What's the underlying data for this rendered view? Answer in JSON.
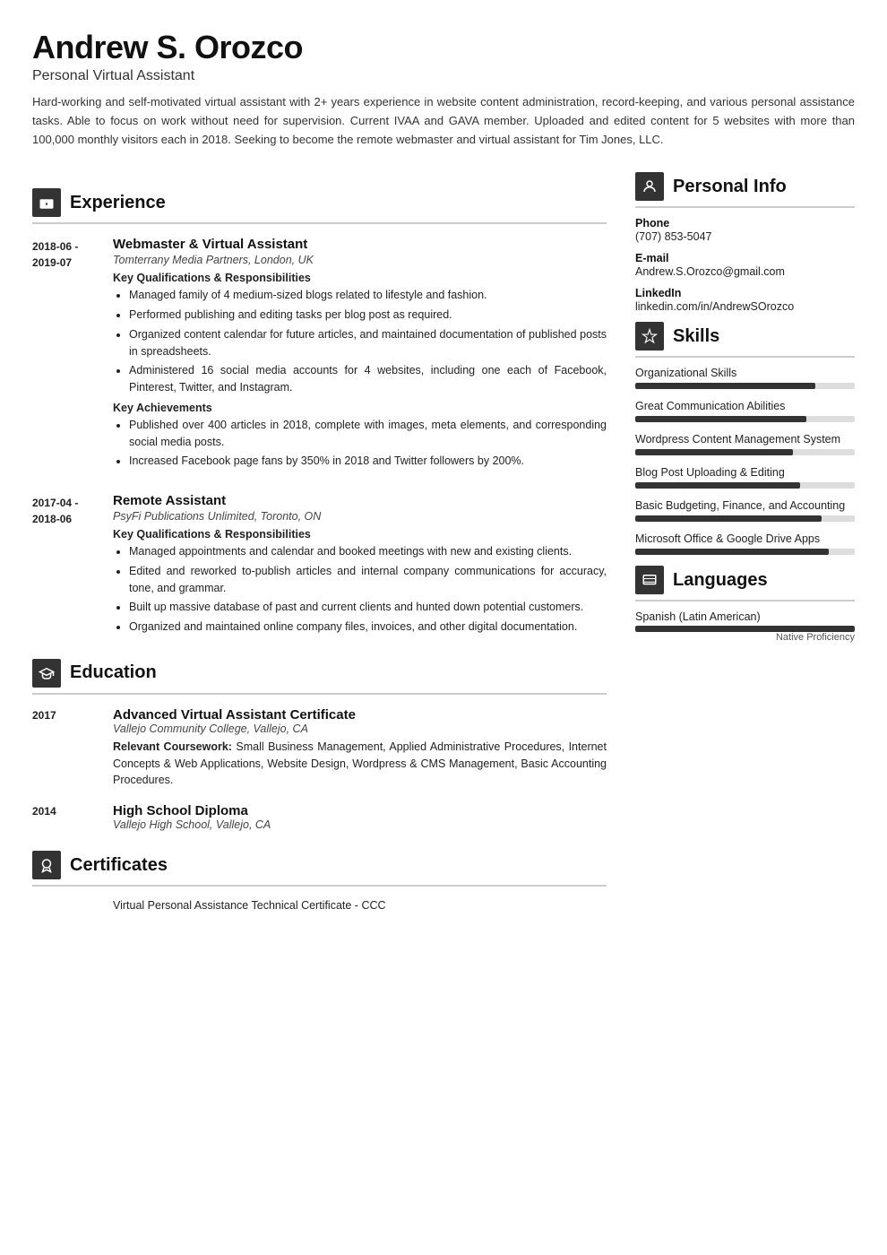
{
  "header": {
    "name": "Andrew S. Orozco",
    "title": "Personal Virtual Assistant",
    "summary": "Hard-working and self-motivated virtual assistant with 2+ years experience in website content administration, record-keeping, and various personal assistance tasks. Able to focus on work without need for supervision. Current IVAA and GAVA member. Uploaded and edited content for 5 websites with more than 100,000 monthly visitors each in 2018. Seeking to become the remote webmaster and virtual assistant for Tim Jones, LLC."
  },
  "experience": {
    "section_label": "Experience",
    "section_icon": "💼",
    "entries": [
      {
        "date": "2018-06 -\n2019-07",
        "title": "Webmaster & Virtual Assistant",
        "company": "Tomterrany Media Partners, London, UK",
        "qualifications_heading": "Key Qualifications & Responsibilities",
        "qualifications": [
          "Managed family of 4 medium-sized blogs related to lifestyle and fashion.",
          "Performed publishing and editing tasks per blog post as required.",
          "Organized content calendar for future articles, and maintained documentation of published posts in spreadsheets.",
          "Administered 16 social media accounts for 4 websites, including one each of Facebook, Pinterest, Twitter, and Instagram."
        ],
        "achievements_heading": "Key Achievements",
        "achievements": [
          "Published over 400 articles in 2018, complete with images, meta elements, and corresponding social media posts.",
          "Increased Facebook page fans by 350% in 2018 and Twitter followers by 200%."
        ]
      },
      {
        "date": "2017-04 -\n2018-06",
        "title": "Remote Assistant",
        "company": "PsyFi Publications Unlimited, Toronto, ON",
        "qualifications_heading": "Key Qualifications & Responsibilities",
        "qualifications": [
          "Managed appointments and calendar and booked meetings with new and existing clients.",
          "Edited and reworked to-publish articles and internal company communications for accuracy, tone, and grammar.",
          "Built up massive database of past and current clients and hunted down potential customers.",
          "Organized and maintained online company files, invoices, and other digital documentation."
        ],
        "achievements_heading": "",
        "achievements": []
      }
    ]
  },
  "education": {
    "section_label": "Education",
    "section_icon": "🎓",
    "entries": [
      {
        "date": "2017",
        "title": "Advanced Virtual Assistant Certificate",
        "school": "Vallejo Community College, Vallejo, CA",
        "coursework_label": "Relevant Coursework:",
        "coursework": "Small Business Management, Applied Administrative Procedures, Internet Concepts & Web Applications, Website Design, Wordpress & CMS Management, Basic Accounting Procedures."
      },
      {
        "date": "2014",
        "title": "High School Diploma",
        "school": "Vallejo High School, Vallejo, CA",
        "coursework_label": "",
        "coursework": ""
      }
    ]
  },
  "certificates": {
    "section_label": "Certificates",
    "section_icon": "🏅",
    "entries": [
      {
        "date": "",
        "text": "Virtual Personal Assistance Technical Certificate - CCC"
      }
    ]
  },
  "personal_info": {
    "section_label": "Personal Info",
    "section_icon": "👤",
    "fields": [
      {
        "label": "Phone",
        "value": "(707) 853-5047"
      },
      {
        "label": "E-mail",
        "value": "Andrew.S.Orozco@gmail.com"
      },
      {
        "label": "LinkedIn",
        "value": "linkedin.com/in/AndrewSOrozco"
      }
    ]
  },
  "skills": {
    "section_label": "Skills",
    "section_icon": "⚙",
    "items": [
      {
        "name": "Organizational Skills",
        "percent": 82
      },
      {
        "name": "Great Communication Abilities",
        "percent": 78
      },
      {
        "name": "Wordpress Content Management System",
        "percent": 72
      },
      {
        "name": "Blog Post Uploading & Editing",
        "percent": 75
      },
      {
        "name": "Basic Budgeting, Finance, and Accounting",
        "percent": 85
      },
      {
        "name": "Microsoft Office & Google Drive Apps",
        "percent": 88
      }
    ]
  },
  "languages": {
    "section_label": "Languages",
    "section_icon": "🏳",
    "items": [
      {
        "name": "Spanish (Latin American)",
        "level": "Native Proficiency",
        "percent": 100
      }
    ]
  }
}
